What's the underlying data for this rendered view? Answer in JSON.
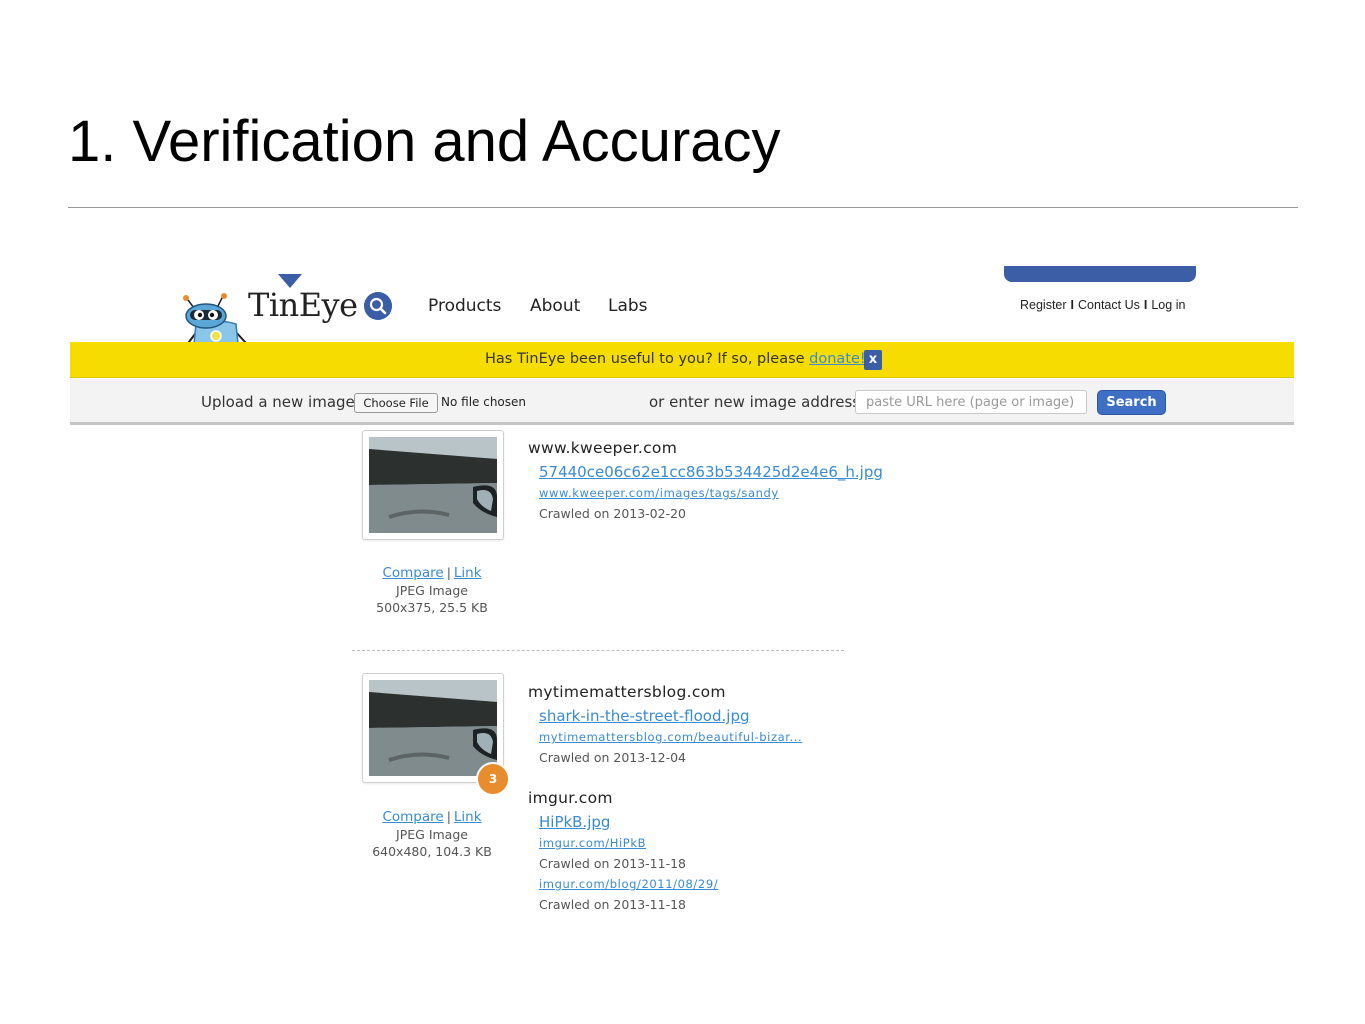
{
  "slide": {
    "title": "1. Verification and Accuracy"
  },
  "header": {
    "brand": "TinEye",
    "nav": [
      "Products",
      "About",
      "Labs"
    ],
    "account": [
      "Register",
      "Contact Us",
      "Log in"
    ],
    "account_separator": "I"
  },
  "donate_bar": {
    "text": "Has TinEye been useful to you? If so, please ",
    "link": "donate!",
    "close": "x"
  },
  "upload_bar": {
    "upload_label": "Upload a new image",
    "choose_file": "Choose File",
    "no_file": "No file chosen",
    "address_label": "or enter new image address",
    "url_placeholder": "paste URL here (page or image)",
    "search_label": "Search"
  },
  "results": [
    {
      "compare": "Compare",
      "link": "Link",
      "type": "JPEG Image",
      "size": "500x375, 25.5 KB",
      "badge": "",
      "sources": [
        {
          "domain": "www.kweeper.com",
          "file": "57440ce06c62e1cc863b534425d2e4e6_h.jpg",
          "pages": [
            {
              "url": "www.kweeper.com/images/tags/sandy",
              "crawled": "Crawled on 2013-02-20"
            }
          ]
        }
      ]
    },
    {
      "compare": "Compare",
      "link": "Link",
      "type": "JPEG Image",
      "size": "640x480, 104.3 KB",
      "badge": "3",
      "sources": [
        {
          "domain": "mytimemattersblog.com",
          "file": "shark-in-the-street-flood.jpg",
          "pages": [
            {
              "url": "mytimemattersblog.com/beautiful-bizar...",
              "crawled": "Crawled on 2013-12-04"
            }
          ]
        },
        {
          "domain": "imgur.com",
          "file": "HiPkB.jpg",
          "pages": [
            {
              "url": "imgur.com/HiPkB",
              "crawled": "Crawled on 2013-11-18"
            },
            {
              "url": "imgur.com/blog/2011/08/29/",
              "crawled": "Crawled on 2013-11-18"
            }
          ]
        }
      ]
    }
  ],
  "colors": {
    "brand_blue": "#3b5ea7",
    "donate_yellow": "#f7dc00",
    "link_blue": "#3a8bd1",
    "badge_orange": "#e88d2e"
  },
  "icons": [
    "tineye-robot-icon",
    "magnifier-icon",
    "close-icon",
    "flood-photo-thumbnail"
  ]
}
